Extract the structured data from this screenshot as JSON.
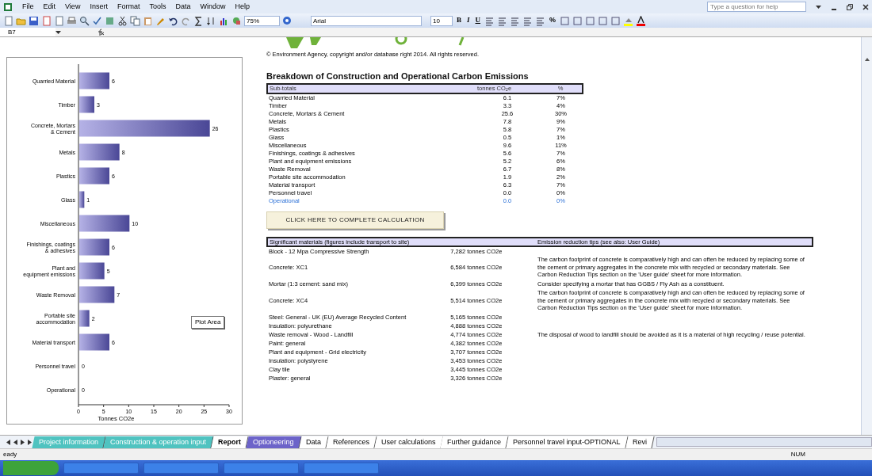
{
  "window": {
    "menu": [
      "File",
      "Edit",
      "View",
      "Insert",
      "Format",
      "Tools",
      "Data",
      "Window",
      "Help"
    ],
    "help_placeholder": "Type a question for help"
  },
  "toolbar": {
    "zoom": "75%",
    "font": "Arial",
    "font_size": "10",
    "format_buttons": [
      "B",
      "I",
      "U"
    ],
    "percent": "%"
  },
  "formula_bar": {
    "name_box": "B7"
  },
  "chart": {
    "tooltip": "Plot Area",
    "chart_data": {
      "type": "bar",
      "orientation": "horizontal",
      "xlabel": "Tonnes CO2e",
      "categories": [
        "Quarried Material",
        "Timber",
        "Concrete, Mortars & Cement",
        "Metals",
        "Plastics",
        "Glass",
        "Miscellaneous",
        "Finishings, coatings & adhesives",
        "Plant and equipment emissions",
        "Waste Removal",
        "Portable site accommodation",
        "Material transport",
        "Personnel travel",
        "Operational"
      ],
      "values": [
        6,
        3,
        26,
        8,
        6,
        1,
        10,
        6,
        5,
        7,
        2,
        6,
        0,
        0
      ],
      "xlim": [
        0,
        30
      ],
      "xticks": [
        0,
        5,
        10,
        15,
        20,
        25,
        30
      ],
      "data_labels": true
    }
  },
  "report": {
    "copyright": "© Environment Agency, copyright and/or database right 2014. All rights reserved.",
    "title": "Breakdown of Construction and Operational Carbon Emissions",
    "subtotals": {
      "columns": [
        "Sub-totals",
        "tonnes CO$_{2}$e",
        "%"
      ],
      "rows": [
        {
          "name": "Quarried Material",
          "value": "6.1",
          "percent": "7%",
          "kind": "material"
        },
        {
          "name": "Timber",
          "value": "3.3",
          "percent": "4%",
          "kind": "material"
        },
        {
          "name": "Concrete, Mortars & Cement",
          "value": "25.6",
          "percent": "30%",
          "kind": "material"
        },
        {
          "name": "Metals",
          "value": "7.8",
          "percent": "9%",
          "kind": "material"
        },
        {
          "name": "Plastics",
          "value": "5.8",
          "percent": "7%",
          "kind": "material"
        },
        {
          "name": "Glass",
          "value": "0.5",
          "percent": "1%",
          "kind": "material"
        },
        {
          "name": "Miscellaneous",
          "value": "9.6",
          "percent": "11%",
          "kind": "material"
        },
        {
          "name": "Finishings, coatings & adhesives",
          "value": "5.6",
          "percent": "7%",
          "kind": "material"
        },
        {
          "name": "Plant and equipment emissions",
          "value": "5.2",
          "percent": "6%",
          "kind": "material"
        },
        {
          "name": "Waste Removal",
          "value": "6.7",
          "percent": "8%",
          "kind": "material"
        },
        {
          "name": "Portable site accommodation",
          "value": "1.9",
          "percent": "2%",
          "kind": "material"
        },
        {
          "name": "Material transport",
          "value": "6.3",
          "percent": "7%",
          "kind": "material"
        },
        {
          "name": "Personnel travel",
          "value": "0.0",
          "percent": "0%",
          "kind": "material"
        },
        {
          "name": "Operational",
          "value": "0.0",
          "percent": "0%",
          "kind": "operational"
        }
      ]
    },
    "button": "CLICK HERE TO COMPLETE CALCULATION",
    "materials": {
      "columns": [
        "Significant materials (figures include transport to site)",
        "Emission reduction tips (see also: User Guide)"
      ],
      "rows": [
        {
          "name": "Block - 12 Mpa Compressive Strength",
          "amount": "7,282 tonnes CO2e"
        },
        {
          "name": "Concrete: XC1",
          "amount": "6,584 tonnes CO2e",
          "tip": "The carbon footprint of concrete is comparatively high and can often be reduced by replacing some of the cement or primary aggregates in the concrete mix with recycled or secondary materials.  See Carbon Reduction Tips section on the 'User guide' sheet for more information."
        },
        {
          "name": "Mortar (1:3 cement: sand mix)",
          "amount": "6,399 tonnes CO2e",
          "tip": "Consider specifying a mortar that has GGBS / Fly Ash as a constituent."
        },
        {
          "name": "Concrete: XC4",
          "amount": "5,514 tonnes CO2e",
          "tip": "The carbon footprint of concrete is comparatively high and can often be reduced by replacing some of the cement or primary aggregates in the concrete mix with recycled or secondary materials.  See Carbon Reduction Tips section on the 'User guide' sheet for more information."
        },
        {
          "name": "Steel: General - UK (EU) Average Recycled Content",
          "amount": "5,165 tonnes CO2e"
        },
        {
          "name": "Insulation: polyurethane",
          "amount": "4,888 tonnes CO2e"
        },
        {
          "name": "Waste removal - Wood - Landfill",
          "amount": "4,774 tonnes CO2e",
          "tip": "The disposal of wood to landfill should be avoided as it is a material of high recycling / reuse potential."
        },
        {
          "name": "Paint: general",
          "amount": "4,382 tonnes CO2e"
        },
        {
          "name": "Plant and equipment - Grid electricity",
          "amount": "3,707 tonnes CO2e"
        },
        {
          "name": "Insulation: polystyrene",
          "amount": "3,453 tonnes CO2e"
        },
        {
          "name": "Clay tile",
          "amount": "3,445 tonnes CO2e"
        },
        {
          "name": "Plaster: general",
          "amount": "3,326 tonnes CO2e"
        }
      ]
    }
  },
  "sheet_tabs": [
    {
      "label": "Project information",
      "selected": false,
      "color": "#4fc3c0"
    },
    {
      "label": "Construction & operation input",
      "selected": false,
      "color": "#4fc3c0"
    },
    {
      "label": "Report",
      "selected": true
    },
    {
      "label": "Optioneering",
      "selected": false,
      "color": "#6c63c9"
    },
    {
      "label": "Data",
      "selected": false
    },
    {
      "label": "References",
      "selected": false
    },
    {
      "label": "User calculations",
      "selected": false
    },
    {
      "label": "Further guidance",
      "selected": false
    },
    {
      "label": "Personnel travel input-OPTIONAL",
      "selected": false
    },
    {
      "label": "Revi",
      "selected": false
    }
  ],
  "status_bar": {
    "mode": "eady",
    "indicator": "NUM"
  }
}
